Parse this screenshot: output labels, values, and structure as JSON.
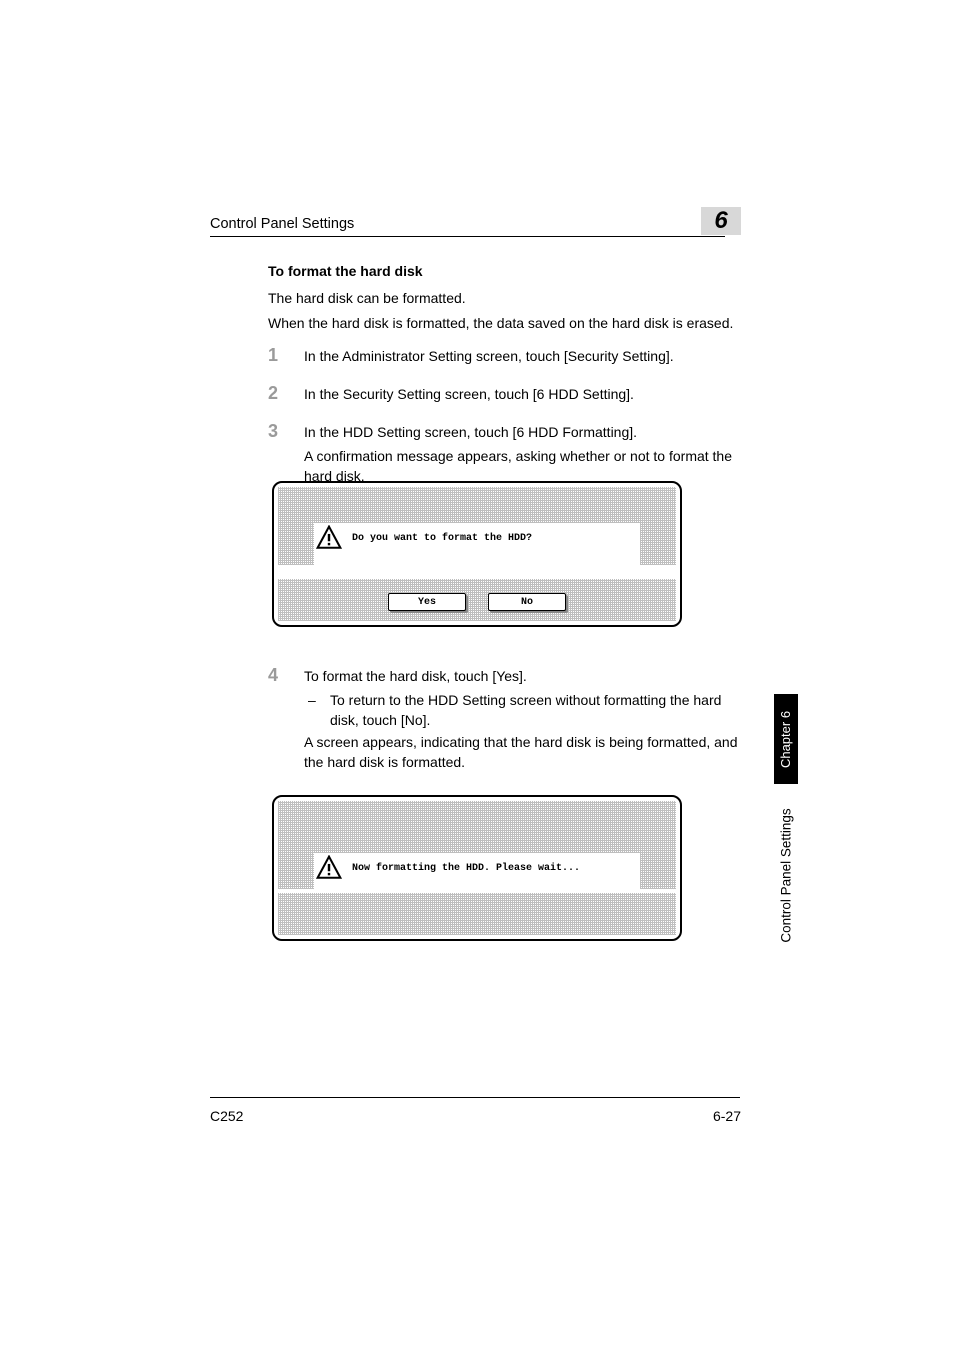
{
  "header": {
    "title": "Control Panel Settings",
    "chapter_display": "6"
  },
  "section": {
    "heading": "To format the hard disk"
  },
  "intro": {
    "p1": "The hard disk can be formatted.",
    "p2": "When the hard disk is formatted, the data saved on the hard disk is erased."
  },
  "steps": {
    "s1": {
      "num": "1",
      "text": "In the Administrator Setting screen, touch [Security Setting]."
    },
    "s2": {
      "num": "2",
      "text": "In the Security Setting screen, touch [6 HDD Setting]."
    },
    "s3": {
      "num": "3",
      "text": "In the HDD Setting screen, touch [6 HDD Formatting].",
      "note": "A confirmation message appears, asking whether or not to format the hard disk."
    },
    "s4": {
      "num": "4",
      "text": "To format the hard disk, touch [Yes].",
      "sub_dash": "–",
      "sub_text": "To return to the HDD Setting screen without formatting the hard disk, touch [No].",
      "after": "A screen appears, indicating that the hard disk is being formatted, and the hard disk is formatted."
    }
  },
  "screenshots": {
    "confirm": {
      "message": "Do you want to format the HDD?",
      "yes": "Yes",
      "no": "No"
    },
    "progress": {
      "message": "Now formatting the HDD. Please wait..."
    }
  },
  "side": {
    "chapter_tab": "Chapter 6",
    "section_tab": "Control Panel Settings"
  },
  "footer": {
    "model": "C252",
    "page": "6-27"
  }
}
